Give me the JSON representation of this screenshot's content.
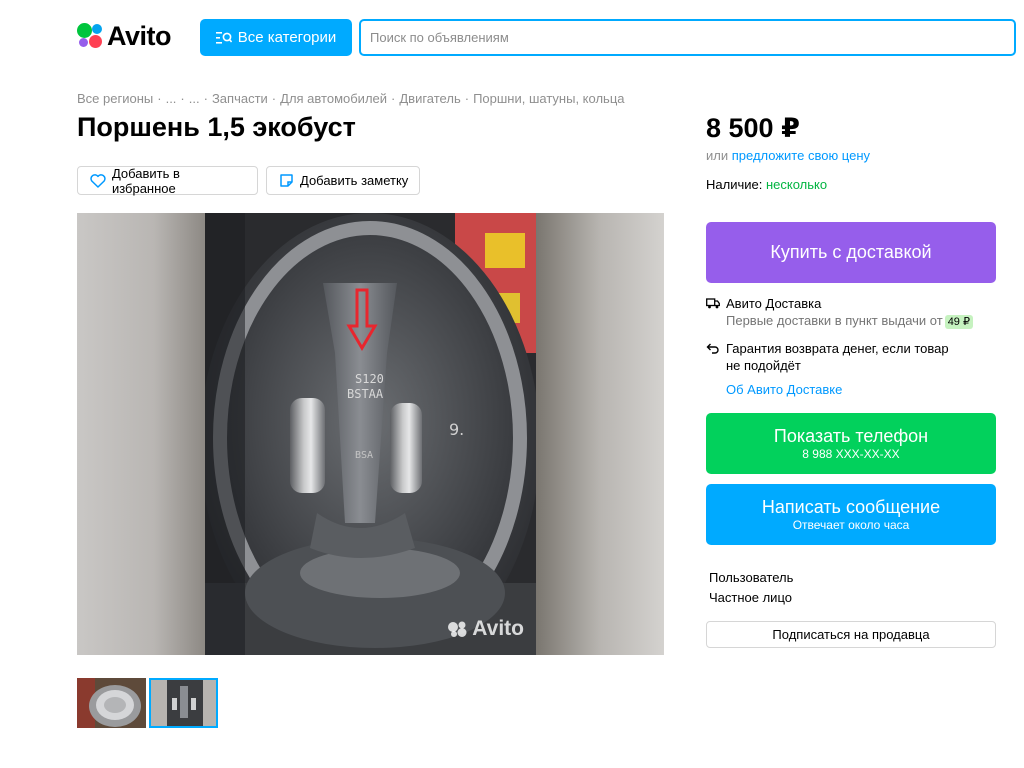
{
  "header": {
    "logo_text": "Avito",
    "categories_label": "Все категории",
    "search_placeholder": "Поиск по объявлениям"
  },
  "breadcrumbs": [
    "Все регионы",
    "...",
    "...",
    "Запчасти",
    "Для автомобилей",
    "Двигатель",
    "Поршни, шатуны, кольца"
  ],
  "listing": {
    "title": "Поршень 1,5 экобуст",
    "favorite_label": "Добавить в избранное",
    "note_label": "Добавить заметку",
    "watermark": "Avito"
  },
  "sidebar": {
    "price": "8 500 ₽",
    "offer_prefix": "или",
    "offer_link": "предложите свою цену",
    "availability_label": "Наличие:",
    "availability_value": "несколько",
    "buy_label": "Купить с доставкой",
    "delivery_title": "Авито Доставка",
    "delivery_sub": "Первые доставки в пункт выдачи от",
    "delivery_price": "49 ₽",
    "guarantee_line1": "Гарантия возврата денег, если товар",
    "guarantee_line2": "не подойдёт",
    "delivery_link": "Об Авито Доставке",
    "phone_label": "Показать телефон",
    "phone_number": "8 988 XXX-XX-XX",
    "message_label": "Написать сообщение",
    "message_sub": "Отвечает около часа",
    "user_name": "Пользователь",
    "user_type": "Частное лицо",
    "subscribe_label": "Подписаться на продавца"
  },
  "colors": {
    "accent_blue": "#00aaff",
    "buy_purple": "#965eeb",
    "phone_green": "#02d15c",
    "link_blue": "#0099ff"
  }
}
